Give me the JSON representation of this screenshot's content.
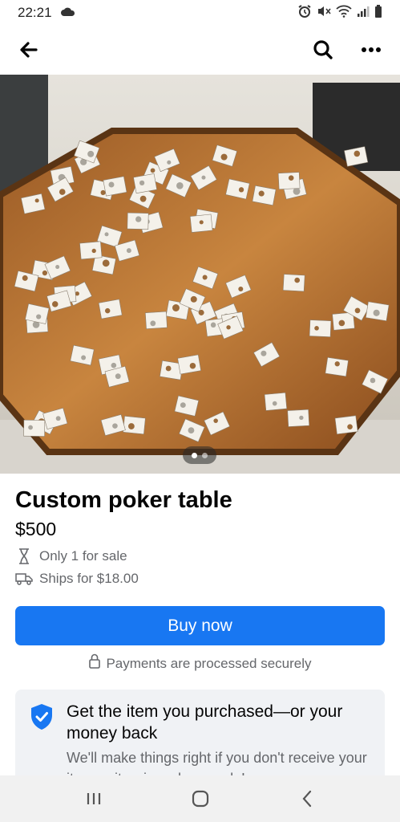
{
  "status_bar": {
    "time": "22:21",
    "icons": [
      "cloud-icon",
      "alarm-icon",
      "mute-icon",
      "wifi-icon",
      "signal-icon",
      "battery-icon"
    ]
  },
  "nav": {
    "icons": [
      "back-arrow-icon",
      "search-icon",
      "more-options-icon"
    ]
  },
  "listing": {
    "photo_alt": "Custom poker table",
    "carousel": {
      "count": 2,
      "active": 1
    },
    "title": "Custom poker table",
    "price": "$500",
    "quantity_text": "Only 1 for sale",
    "shipping_text": "Ships for $18.00",
    "buy_button": "Buy now",
    "secure_text": "Payments are processed securely"
  },
  "protection": {
    "title": "Get the item you purchased—or your money back",
    "body": "We'll make things right if you don't receive your item or it arrives damaged. Learn"
  },
  "system_nav": {
    "icons": [
      "recent-apps-icon",
      "home-icon",
      "back-icon"
    ]
  },
  "colors": {
    "accent": "#1877f2",
    "secondary_text": "#65676b",
    "card_bg": "#f0f2f5",
    "table_wood": "#b8743a"
  }
}
